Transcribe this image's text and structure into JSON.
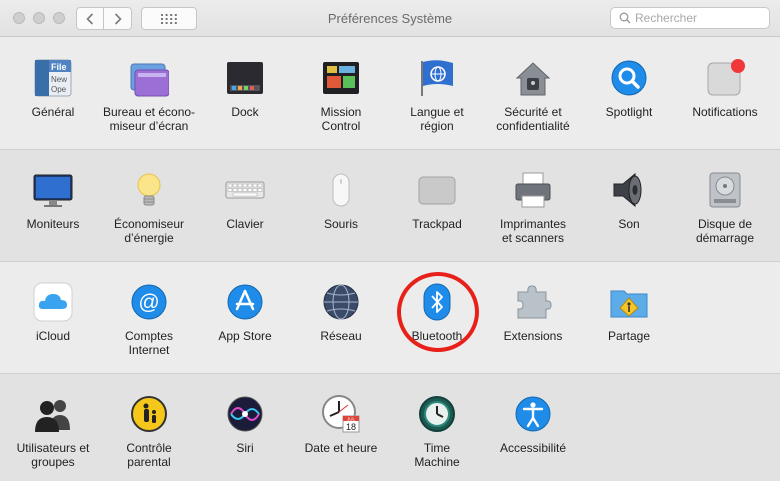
{
  "window": {
    "title": "Préférences Système",
    "search_placeholder": "Rechercher"
  },
  "rows": [
    [
      {
        "label": "Général",
        "icon": "general-icon"
      },
      {
        "label": "Bureau et écono-\nmiseur d’écran",
        "icon": "desktop-screensaver-icon"
      },
      {
        "label": "Dock",
        "icon": "dock-icon"
      },
      {
        "label": "Mission\nControl",
        "icon": "mission-control-icon"
      },
      {
        "label": "Langue et\nrégion",
        "icon": "flag-globe-icon"
      },
      {
        "label": "Sécurité et\nconfidentialité",
        "icon": "house-lock-icon"
      },
      {
        "label": "Spotlight",
        "icon": "magnifier-icon"
      },
      {
        "label": "Notifications",
        "icon": "notifications-icon"
      }
    ],
    [
      {
        "label": "Moniteurs",
        "icon": "monitor-icon"
      },
      {
        "label": "Économiseur\nd’énergie",
        "icon": "lightbulb-icon"
      },
      {
        "label": "Clavier",
        "icon": "keyboard-icon"
      },
      {
        "label": "Souris",
        "icon": "mouse-icon"
      },
      {
        "label": "Trackpad",
        "icon": "trackpad-icon"
      },
      {
        "label": "Imprimantes\net scanners",
        "icon": "printer-icon"
      },
      {
        "label": "Son",
        "icon": "speaker-icon"
      },
      {
        "label": "Disque de\ndémarrage",
        "icon": "hard-drive-icon"
      }
    ],
    [
      {
        "label": "iCloud",
        "icon": "icloud-icon"
      },
      {
        "label": "Comptes\nInternet",
        "icon": "at-sign-icon"
      },
      {
        "label": "App Store",
        "icon": "app-store-icon"
      },
      {
        "label": "Réseau",
        "icon": "network-globe-icon"
      },
      {
        "label": "Bluetooth",
        "icon": "bluetooth-icon"
      },
      {
        "label": "Extensions",
        "icon": "puzzle-icon"
      },
      {
        "label": "Partage",
        "icon": "sharing-folder-icon"
      }
    ],
    [
      {
        "label": "Utilisateurs et\ngroupes",
        "icon": "users-icon"
      },
      {
        "label": "Contrôle\nparental",
        "icon": "parental-control-icon"
      },
      {
        "label": "Siri",
        "icon": "siri-icon"
      },
      {
        "label": "Date et heure",
        "icon": "clock-calendar-icon"
      },
      {
        "label": "Time\nMachine",
        "icon": "time-machine-icon"
      },
      {
        "label": "Accessibilité",
        "icon": "accessibility-icon"
      }
    ]
  ],
  "calendar_icon": {
    "month": "JUL",
    "day": "18"
  },
  "annotation": {
    "highlight": "Bluetooth",
    "color": "#e8201a"
  }
}
